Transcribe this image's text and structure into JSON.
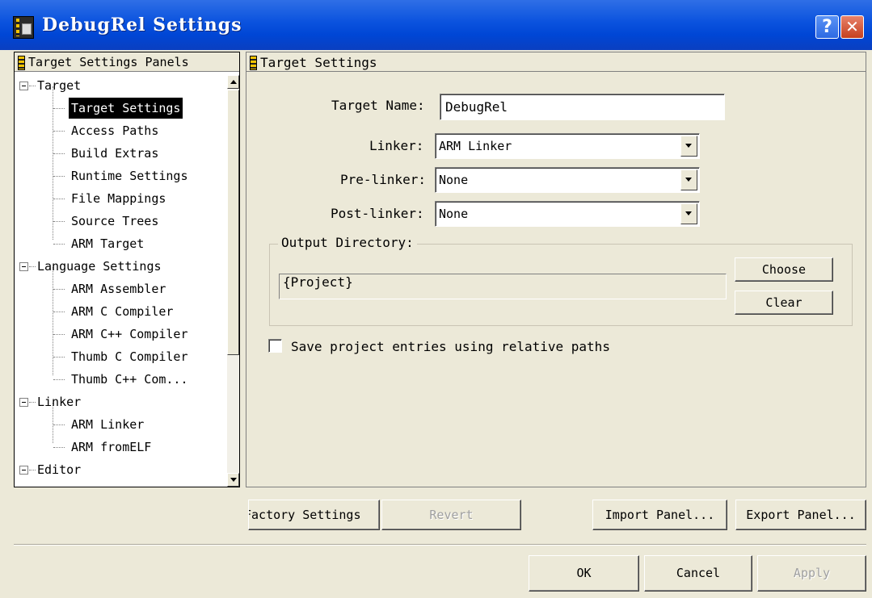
{
  "window": {
    "title": "DebugRel Settings",
    "help_label": "?",
    "close_label": "✕"
  },
  "tree": {
    "header": "Target Settings Panels",
    "items": [
      {
        "label": "Target",
        "group": true
      },
      {
        "label": "Target Settings",
        "selected": true
      },
      {
        "label": "Access Paths"
      },
      {
        "label": "Build Extras"
      },
      {
        "label": "Runtime Settings"
      },
      {
        "label": "File Mappings"
      },
      {
        "label": "Source Trees"
      },
      {
        "label": "ARM Target"
      },
      {
        "label": "Language Settings",
        "group": true
      },
      {
        "label": "ARM Assembler"
      },
      {
        "label": "ARM C Compiler"
      },
      {
        "label": "ARM C++ Compiler"
      },
      {
        "label": "Thumb C Compiler"
      },
      {
        "label": "Thumb C++ Com..."
      },
      {
        "label": "Linker",
        "group": true
      },
      {
        "label": "ARM Linker"
      },
      {
        "label": "ARM fromELF"
      },
      {
        "label": "Editor",
        "group": true
      }
    ]
  },
  "panel": {
    "header": "Target Settings",
    "target_name_label": "Target Name:",
    "target_name_value": "DebugRel",
    "linker_label": "Linker:",
    "linker_value": "ARM Linker",
    "prelinker_label": "Pre-linker:",
    "prelinker_value": "None",
    "postlinker_label": "Post-linker:",
    "postlinker_value": "None",
    "output_dir_label": "Output Directory:",
    "output_dir_value": "{Project}",
    "choose_label": "Choose",
    "clear_label": "Clear",
    "save_relative_label": "Save project entries using relative paths",
    "save_relative_checked": false
  },
  "panel_buttons": {
    "factory": "Factory Settings",
    "revert": "Revert",
    "import": "Import Panel...",
    "export": "Export Panel..."
  },
  "dialog_buttons": {
    "ok": "OK",
    "cancel": "Cancel",
    "apply": "Apply"
  },
  "colors": {
    "titlebar": "#0a52de",
    "dialog_bg": "#ece9d8",
    "selection": "#000000"
  }
}
